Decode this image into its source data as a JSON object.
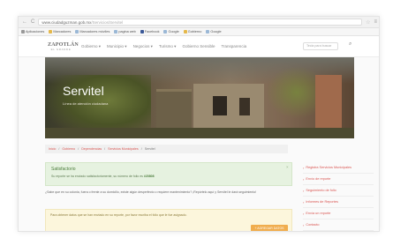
{
  "browser": {
    "url_host": "www.ciudadguzman.gob.mx",
    "url_path": "/Servicios/Servitel",
    "bookmarks": [
      {
        "label": "Aplicaciones",
        "color": "#999999"
      },
      {
        "label": "Marcadores",
        "color": "#e5b84a"
      },
      {
        "label": "Marcadores móviles",
        "color": "#9bb8d6"
      },
      {
        "label": "pagina web",
        "color": "#9bb8d6"
      },
      {
        "label": "Facebook",
        "color": "#3b5998"
      },
      {
        "label": "Google",
        "color": "#9bb8d6"
      },
      {
        "label": "Gobierno",
        "color": "#e5b84a"
      },
      {
        "label": "Google",
        "color": "#9bb8d6"
      }
    ]
  },
  "site": {
    "logo_main": "ZAPOTLÁN",
    "logo_sub": "EL GRANDE",
    "menu": [
      "Gobierno ▾",
      "Municipio ▾",
      "Negocios ▾",
      "Turismo ▾",
      "Gobierno Sensible",
      "Transparencia"
    ],
    "search_placeholder": "Tecla para buscar"
  },
  "hero": {
    "title": "Servitel",
    "subtitle": "Línea de atención ciudadana"
  },
  "breadcrumb": [
    "Inicio",
    "/",
    "Gobierno",
    "/",
    "Dependencias",
    "/",
    "Servicios Municipales",
    "/",
    "Servitel"
  ],
  "notice": {
    "title": "Satisfactorio",
    "text_before": "Su reporte se ha enviado satisfactoriamente, su número de folio es ",
    "folio": "#20808"
  },
  "paragraph": "¿Sabe que en su colonia, fuera o frente a su domicilio, existe algún desperfecto o requiere mantenimiento? ¡Repórtelo aquí y Servitel le dará seguimiento!",
  "warning": {
    "text": "Para obtener datos que se han enviado en su reporte, por favor escriba el folio que le fue asignado.",
    "button": "+ AGREGAR DATOS"
  },
  "sidebar": [
    "Registra Servicios Municipales",
    "Envío de reporte",
    "Seguimiento de folio",
    "Informes de Reportes",
    "Envía un reporte",
    "Contacto"
  ],
  "colors": {
    "accent": "#d9534f",
    "success_bg": "#e6f2e0",
    "warning_bg": "#fcf6dc",
    "button": "#f0ad4e"
  }
}
